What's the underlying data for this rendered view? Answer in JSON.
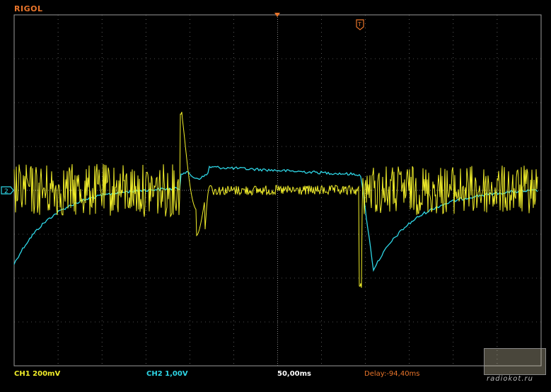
{
  "brand": "RIGOL",
  "status": {
    "ch1": "CH1 200mV",
    "ch2": "CH2 1,00V",
    "timebase": "50,00ms",
    "delay": "Delay:-94,40ms"
  },
  "markers": {
    "ch2_ground_label": "2",
    "trigger_label": "T"
  },
  "watermark": {
    "site": "radiokot.ru"
  },
  "colors": {
    "ch1": "#f2ef2a",
    "ch2": "#2ed6e6",
    "brand": "#e8742a",
    "grid": "#9a9a9a"
  }
}
